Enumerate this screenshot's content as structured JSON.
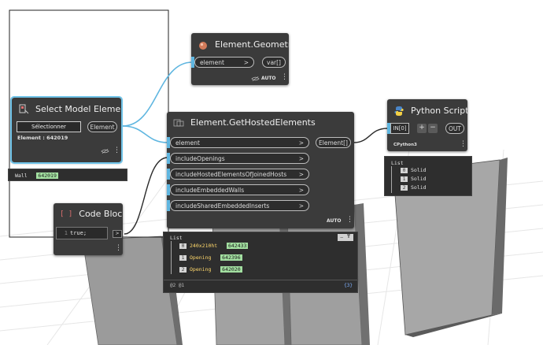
{
  "nodes": {
    "select": {
      "title": "Select Model Element",
      "button_label": "Sélectionner",
      "out_label": "Element",
      "info": "Element : 642019",
      "preview_label": "Wall",
      "preview_value": "642019"
    },
    "geometry": {
      "title": "Element.Geometry",
      "in_label": "element",
      "in_arrow": ">",
      "out_label": "var[]",
      "lacing": "AUTO"
    },
    "hosted": {
      "title": "Element.GetHostedElements",
      "inputs": [
        "element",
        "includeOpenings",
        "includeHostedElementsOfJoinedHosts",
        "includeEmbeddedWalls",
        "includeSharedEmbeddedInserts"
      ],
      "arrow": ">",
      "out_label": "Element[]",
      "lacing": "AUTO",
      "preview": {
        "header": "List",
        "items": [
          {
            "index": "0",
            "label": "240x210ht",
            "value": "642433"
          },
          {
            "index": "1",
            "label": "Opening",
            "value": "642396"
          },
          {
            "index": "2",
            "label": "Opening",
            "value": "642020"
          }
        ],
        "footer_levels": "@2 @1",
        "footer_count": "{3}",
        "pin_label": "–"
      }
    },
    "code": {
      "title": "Code Block",
      "line_number": "1",
      "code": "true;",
      "out_arrow": ">",
      "menu": "⋮"
    },
    "python": {
      "title": "Python Script",
      "in_label": "IN[0]",
      "plus": "+",
      "minus": "−",
      "out_label": "OUT",
      "engine": "CPython3",
      "preview": {
        "header": "List",
        "items": [
          {
            "index": "0",
            "value": "Solid"
          },
          {
            "index": "1",
            "value": "Solid"
          },
          {
            "index": "2",
            "value": "Solid"
          }
        ]
      }
    }
  },
  "menu_glyph": "⋮",
  "colors": {
    "node_body": "#3b3b3b",
    "wire_blue": "#5fb6e0",
    "wire_dark": "#2a2a2a",
    "highlight": "#a3e0a1",
    "selection": "#6fc3e8"
  }
}
